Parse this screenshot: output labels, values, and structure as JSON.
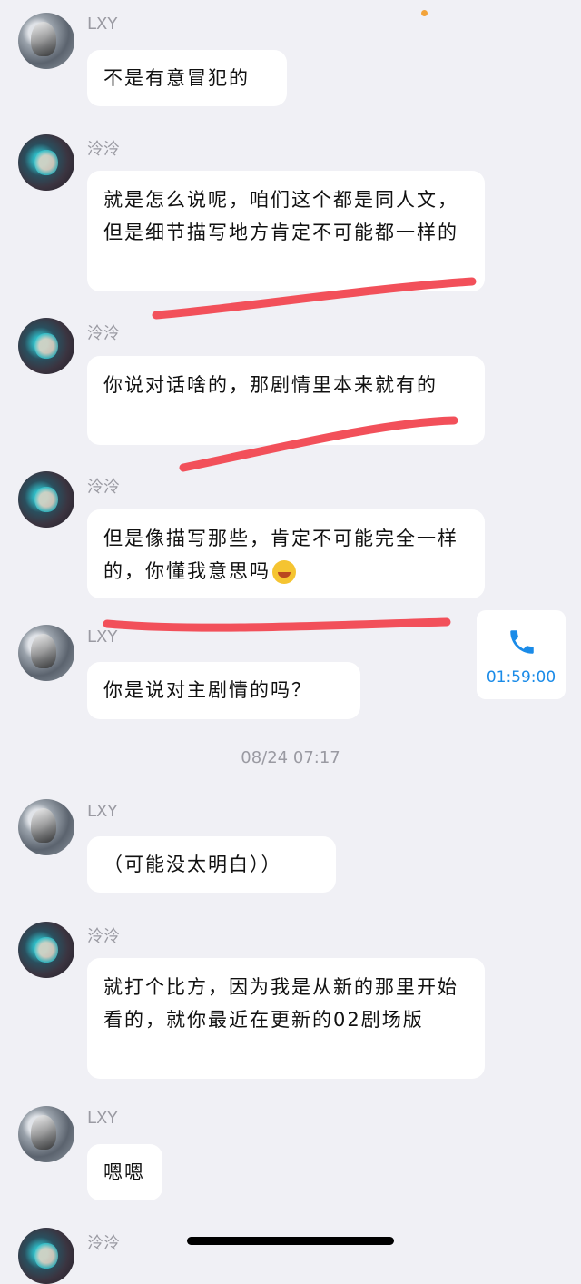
{
  "messages": [
    {
      "sender": "LXY",
      "text": "不是有意冒犯的"
    },
    {
      "sender": "泠泠",
      "text": "就是怎么说呢，咱们这个都是同人文，但是细节描写地方肯定不可能都一样的"
    },
    {
      "sender": "泠泠",
      "text": "你说对话啥的，那剧情里本来就有的"
    },
    {
      "sender": "泠泠",
      "text": "但是像描写那些，肯定不可能完全一样的，你懂我意思吗"
    },
    {
      "sender": "LXY",
      "text": "你是说对主剧情的吗？"
    },
    {
      "sender": "LXY",
      "text": "（可能没太明白））"
    },
    {
      "sender": "泠泠",
      "text": "就打个比方，因为我是从新的那里开始看的，就你最近在更新的02剧场版"
    },
    {
      "sender": "LXY",
      "text": "嗯嗯"
    },
    {
      "sender": "泠泠",
      "text": ""
    }
  ],
  "timestamp": "08/24 07:17",
  "call": {
    "duration": "01:59:00",
    "icon": "phone-icon",
    "color": "#1a8be8"
  },
  "colors": {
    "background": "#f0f0f5",
    "bubble": "#ffffff",
    "annotation": "#f2505a",
    "name": "#9a9aa2"
  }
}
